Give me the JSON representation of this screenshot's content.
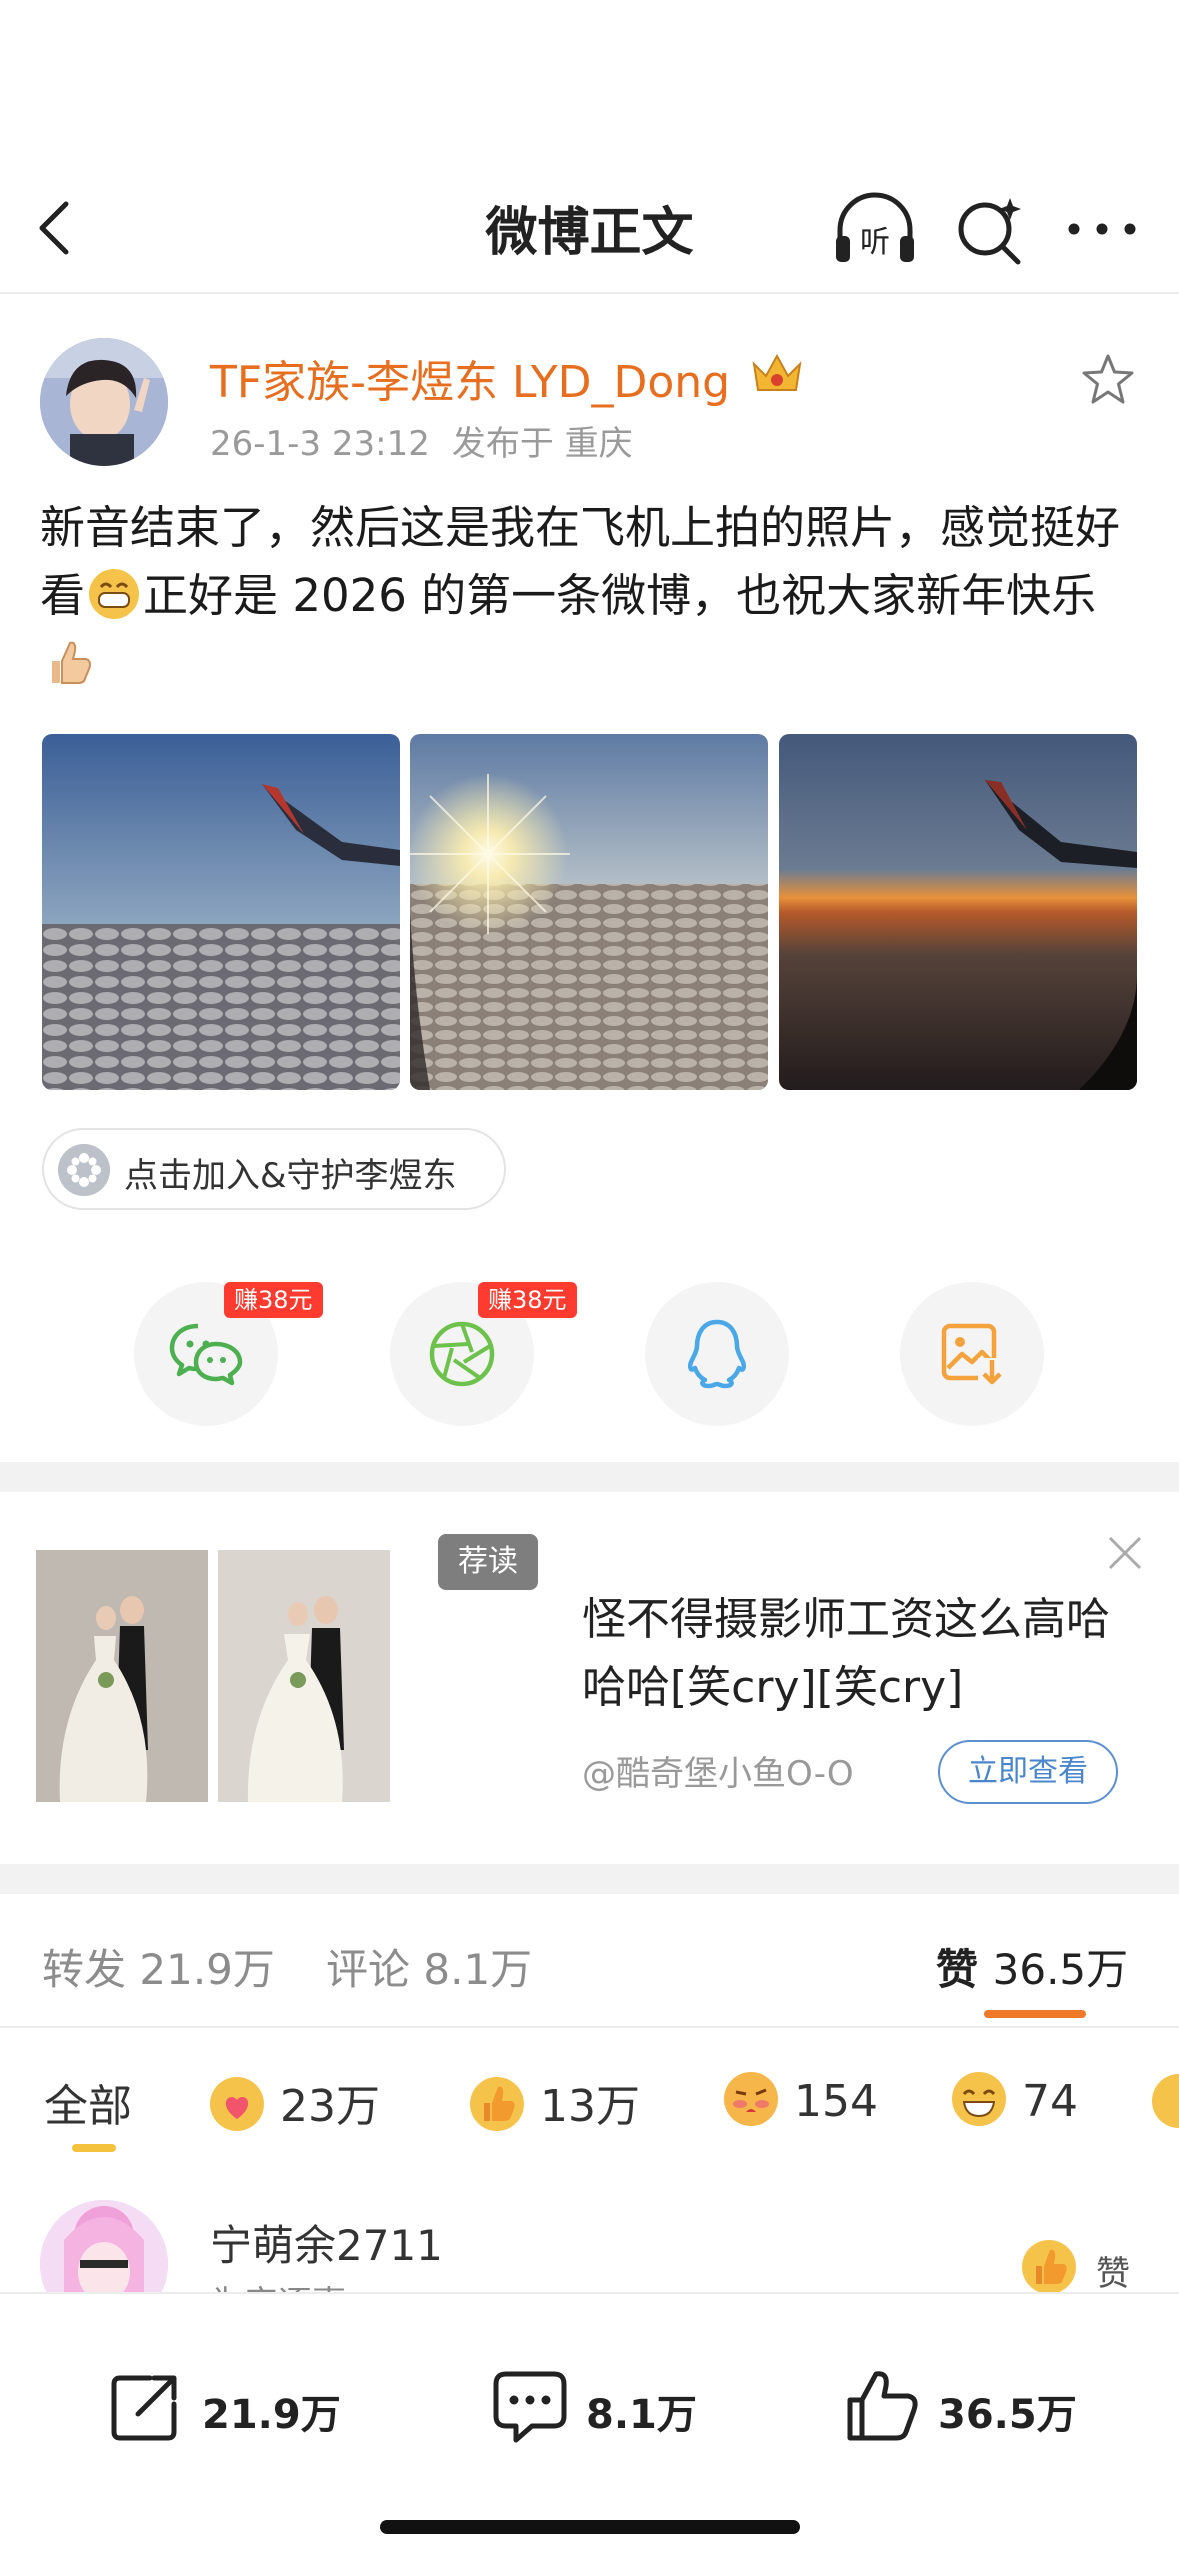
{
  "nav": {
    "title": "微博正文"
  },
  "author": {
    "name": "TF家族-李煜东 LYD_Dong",
    "time": "26-1-3 23:12",
    "location": "发布于 重庆"
  },
  "post": {
    "text1": "新音结束了，然后这是我在飞机上拍的照片，感觉挺好看",
    "text2": "正好是 2026 的第一条微博，也祝大家新年快乐",
    "photo_count": 3
  },
  "guard": {
    "label": "点击加入&守护李煜东"
  },
  "share": {
    "badge_wechat": "赚38元",
    "badge_moments": "赚38元",
    "icons": [
      "wechat-icon",
      "moments-icon",
      "qq-icon",
      "save-image-icon"
    ]
  },
  "ad": {
    "tag": "荐读",
    "title": "怪不得摄影师工资这么高哈哈哈[笑cry][笑cry]",
    "source": "@酷奇堡小鱼O-O",
    "cta": "立即查看"
  },
  "stats": {
    "repost_label": "转发",
    "repost": "21.9万",
    "comment_label": "评论",
    "comment": "8.1万",
    "like_label": "赞",
    "like": "36.5万"
  },
  "reactions": {
    "all": "全部",
    "items": [
      {
        "icon": "heart-face-icon",
        "count": "23万"
      },
      {
        "icon": "thumbs-up-icon",
        "count": "13万"
      },
      {
        "icon": "kiss-face-icon",
        "count": "154"
      },
      {
        "icon": "grin-face-icon",
        "count": "74"
      }
    ]
  },
  "comment": {
    "user": "宁萌余2711",
    "sub": "为宠逐嘉",
    "like_label": "赞"
  },
  "bottom": {
    "repost": "21.9万",
    "comment": "8.1万",
    "like": "36.5万"
  },
  "colors": {
    "accent": "#e86e1f",
    "earn": "#ff3b30",
    "link": "#4a86cc"
  }
}
